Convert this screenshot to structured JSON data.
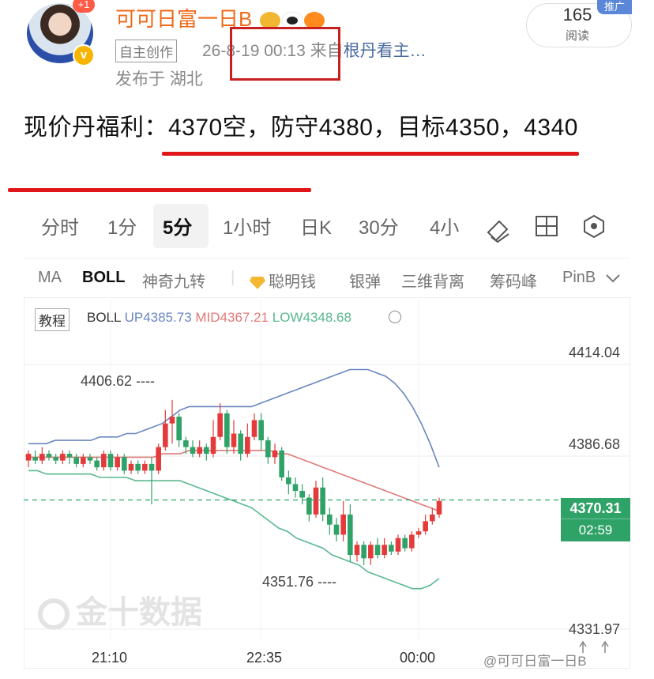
{
  "header": {
    "notif_badge": "+1",
    "username": "可可日富一日B",
    "tag": "自主创作",
    "datetime": "26-8-19 00:13",
    "from_prefix": "来自",
    "source": "根丹看主…",
    "location": "发布于 湖北",
    "read_count": "165",
    "read_label": "阅读",
    "promo": "推广"
  },
  "post": {
    "text": "现价丹福利：4370空，防守4380，目标4350，4340"
  },
  "tabs": [
    "分时",
    "1分",
    "5分",
    "1小时",
    "日K",
    "30分",
    "4小"
  ],
  "active_tab": "5分",
  "indicators": {
    "items": [
      "MA",
      "BOLL",
      "神奇九转",
      "聪明钱",
      "银弹",
      "三维背离",
      "筹码峰",
      "PinB"
    ],
    "active": "BOLL"
  },
  "chart_header": {
    "tutorial": "教程",
    "name": "BOLL",
    "up": "UP4385.73",
    "mid": "MID4367.21",
    "low": "LOW4348.68"
  },
  "chart_data": {
    "type": "candlestick",
    "indicator": "BOLL",
    "y_ticks": [
      "4414.04",
      "4386.68",
      "4331.97"
    ],
    "ylim": [
      4331.97,
      4414.04
    ],
    "x_ticks": [
      "21:10",
      "22:35",
      "00:00"
    ],
    "high_label": "4406.62",
    "low_label": "4351.76",
    "current_price": "4370.31",
    "countdown": "02:59",
    "colors": {
      "up": "#e33b3b",
      "down": "#2fa268",
      "boll_up": "#6a86c0",
      "boll_mid": "#e07a78",
      "boll_low": "#58b88e"
    },
    "candles": [
      [
        4382,
        4384,
        4380,
        4385
      ],
      [
        4383,
        4382,
        4381,
        4385
      ],
      [
        4382,
        4384,
        4381,
        4386
      ],
      [
        4384,
        4383,
        4382,
        4385
      ],
      [
        4383,
        4382,
        4381,
        4384
      ],
      [
        4382,
        4384,
        4381,
        4385
      ],
      [
        4384,
        4383,
        4381,
        4385
      ],
      [
        4383,
        4381,
        4380,
        4384
      ],
      [
        4381,
        4383,
        4380,
        4384
      ],
      [
        4383,
        4382,
        4381,
        4384
      ],
      [
        4382,
        4380,
        4379,
        4383
      ],
      [
        4380,
        4384,
        4379,
        4385
      ],
      [
        4384,
        4380,
        4379,
        4385
      ],
      [
        4380,
        4383,
        4379,
        4384
      ],
      [
        4383,
        4379,
        4378,
        4384
      ],
      [
        4379,
        4381,
        4378,
        4382
      ],
      [
        4381,
        4379,
        4378,
        4382
      ],
      [
        4379,
        4381,
        4378,
        4382
      ],
      [
        4381,
        4379,
        4369,
        4383
      ],
      [
        4379,
        4386,
        4378,
        4387
      ],
      [
        4386,
        4393,
        4385,
        4397
      ],
      [
        4393,
        4395,
        4387,
        4400
      ],
      [
        4395,
        4388,
        4386,
        4396
      ],
      [
        4388,
        4386,
        4384,
        4389
      ],
      [
        4386,
        4384,
        4383,
        4388
      ],
      [
        4384,
        4386,
        4383,
        4388
      ],
      [
        4386,
        4384,
        4382,
        4387
      ],
      [
        4384,
        4389,
        4383,
        4394
      ],
      [
        4389,
        4396,
        4388,
        4399
      ],
      [
        4396,
        4386,
        4384,
        4397
      ],
      [
        4386,
        4390,
        4384,
        4394
      ],
      [
        4390,
        4384,
        4382,
        4391
      ],
      [
        4384,
        4389,
        4383,
        4393
      ],
      [
        4389,
        4394,
        4388,
        4396
      ],
      [
        4394,
        4388,
        4385,
        4396
      ],
      [
        4388,
        4383,
        4381,
        4389
      ],
      [
        4383,
        4385,
        4381,
        4387
      ],
      [
        4385,
        4377,
        4376,
        4386
      ],
      [
        4377,
        4375,
        4372,
        4379
      ],
      [
        4375,
        4373,
        4371,
        4377
      ],
      [
        4373,
        4371,
        4369,
        4375
      ],
      [
        4371,
        4366,
        4364,
        4372
      ],
      [
        4366,
        4374,
        4365,
        4376
      ],
      [
        4374,
        4366,
        4364,
        4377
      ],
      [
        4366,
        4363,
        4360,
        4368
      ],
      [
        4363,
        4360,
        4358,
        4365
      ],
      [
        4360,
        4366,
        4358,
        4370
      ],
      [
        4366,
        4354,
        4352,
        4369
      ],
      [
        4354,
        4357,
        4352,
        4358
      ],
      [
        4357,
        4353,
        4351,
        4358
      ],
      [
        4353,
        4357,
        4351,
        4358
      ],
      [
        4357,
        4354,
        4353,
        4359
      ],
      [
        4354,
        4357,
        4353,
        4359
      ],
      [
        4357,
        4355,
        4354,
        4358
      ],
      [
        4355,
        4359,
        4354,
        4360
      ],
      [
        4359,
        4356,
        4355,
        4360
      ],
      [
        4356,
        4360,
        4355,
        4361
      ],
      [
        4360,
        4361,
        4359,
        4362
      ],
      [
        4361,
        4364,
        4360,
        4366
      ],
      [
        4364,
        4366,
        4363,
        4368
      ],
      [
        4366,
        4370,
        4365,
        4371
      ]
    ],
    "boll_up": [
      4387,
      4387,
      4387,
      4388,
      4388,
      4388,
      4388,
      4388,
      4389,
      4389,
      4389,
      4390,
      4390,
      4391,
      4392,
      4393,
      4395,
      4397,
      4398,
      4398,
      4398,
      4398,
      4398,
      4398,
      4398,
      4398,
      4399,
      4400,
      4401,
      4402,
      4403,
      4404,
      4405,
      4406,
      4407,
      4408,
      4409,
      4409,
      4409,
      4408,
      4407,
      4405,
      4402,
      4398,
      4393,
      4387,
      4380
    ],
    "boll_mid": [
      4383,
      4383,
      4383,
      4383,
      4383,
      4383,
      4383,
      4383,
      4383,
      4383,
      4383,
      4383,
      4383,
      4383,
      4383,
      4384,
      4384,
      4384,
      4385,
      4385,
      4385,
      4385,
      4385,
      4385,
      4385,
      4385,
      4385,
      4385,
      4384,
      4384,
      4383,
      4382,
      4381,
      4380,
      4379,
      4378,
      4377,
      4376,
      4375,
      4374,
      4373,
      4372,
      4371,
      4370,
      4369,
      4368,
      4367
    ],
    "boll_low": [
      4379,
      4379,
      4378,
      4378,
      4378,
      4378,
      4378,
      4378,
      4377,
      4377,
      4377,
      4377,
      4376,
      4376,
      4376,
      4376,
      4376,
      4376,
      4375,
      4374,
      4373,
      4372,
      4371,
      4370,
      4369,
      4368,
      4366,
      4364,
      4362,
      4361,
      4359,
      4358,
      4357,
      4356,
      4354,
      4353,
      4352,
      4351,
      4349,
      4348,
      4347,
      4346,
      4345,
      4344,
      4344,
      4345,
      4347
    ]
  },
  "watermark": "金十数据",
  "weibo_credit": "@可可日富一日B"
}
